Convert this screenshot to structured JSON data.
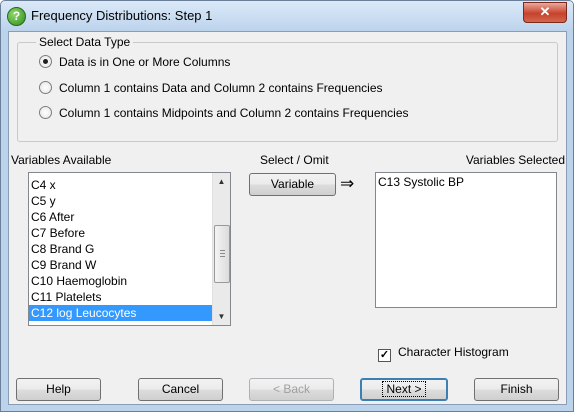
{
  "window": {
    "title": "Frequency Distributions: Step 1",
    "title_icon": "question-icon",
    "close_icon": "close-icon"
  },
  "data_type": {
    "legend": "Select Data Type",
    "options": [
      {
        "label": "Data is in One or More Columns",
        "checked": true
      },
      {
        "label": "Column 1 contains Data and Column 2 contains Frequencies",
        "checked": false
      },
      {
        "label": "Column 1 contains Midpoints and Column 2 contains Frequencies",
        "checked": false
      }
    ]
  },
  "variables": {
    "available_label": "Variables Available",
    "select_omit_label": "Select / Omit",
    "selected_label": "Variables Selected",
    "variable_button": "Variable",
    "arrow_glyph": "⇒",
    "available": [
      {
        "label": "C4 x",
        "selected": false
      },
      {
        "label": "C5 y",
        "selected": false
      },
      {
        "label": "C6 After",
        "selected": false
      },
      {
        "label": "C7 Before",
        "selected": false
      },
      {
        "label": "C8 Brand G",
        "selected": false
      },
      {
        "label": "C9 Brand W",
        "selected": false
      },
      {
        "label": "C10 Haemoglobin",
        "selected": false
      },
      {
        "label": "C11 Platelets",
        "selected": false
      },
      {
        "label": "C12 log Leucocytes",
        "selected": true
      }
    ],
    "selected": [
      "C13 Systolic BP"
    ]
  },
  "options": {
    "character_histogram_label": "Character Histogram",
    "character_histogram_checked": true
  },
  "buttons": {
    "help": "Help",
    "cancel": "Cancel",
    "back": "< Back",
    "next": "Next >",
    "finish": "Finish",
    "back_enabled": false
  },
  "colors": {
    "selection": "#3399ff",
    "close_button": "#c7422b",
    "titlebar": "#bcd3ec"
  }
}
